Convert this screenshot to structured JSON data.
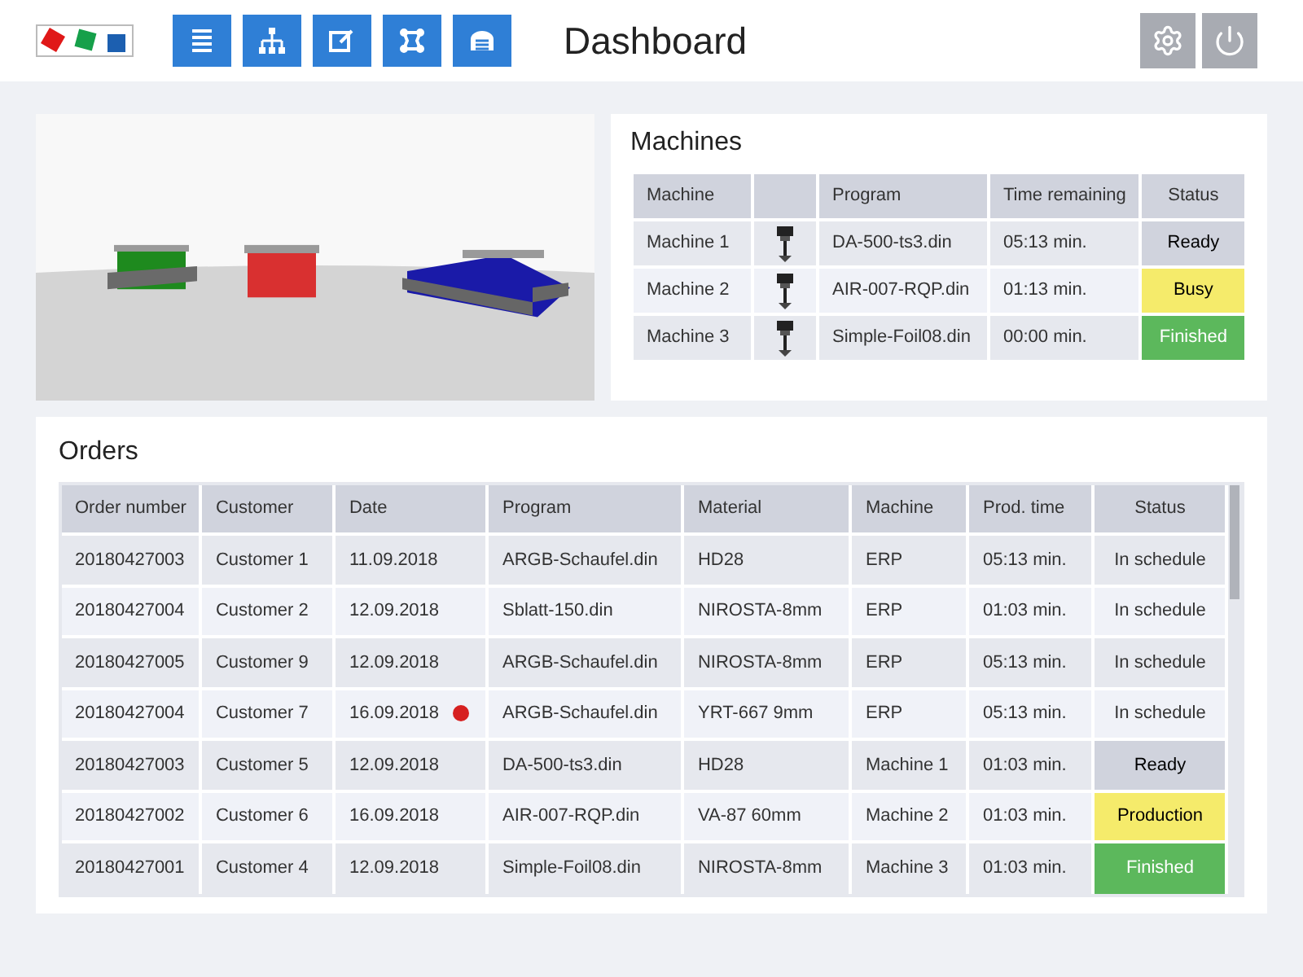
{
  "header": {
    "title": "Dashboard"
  },
  "machines": {
    "title": "Machines",
    "columns": [
      "Machine",
      "",
      "Program",
      "Time remaining",
      "Status"
    ],
    "rows": [
      {
        "machine": "Machine 1",
        "program": "DA-500-ts3.din",
        "time": "05:13 min.",
        "status": "Ready",
        "kind": "ready"
      },
      {
        "machine": "Machine 2",
        "program": "AIR-007-RQP.din",
        "time": "01:13 min.",
        "status": "Busy",
        "kind": "busy"
      },
      {
        "machine": "Machine 3",
        "program": "Simple-Foil08.din",
        "time": "00:00 min.",
        "status": "Finished",
        "kind": "finished"
      }
    ]
  },
  "orders": {
    "title": "Orders",
    "columns": [
      "Order number",
      "Customer",
      "Date",
      "Program",
      "Material",
      "Machine",
      "Prod. time",
      "Status"
    ],
    "rows": [
      {
        "cells": [
          "20180427003",
          "Customer 1",
          "11.09.2018",
          "ARGB-Schaufel.din",
          "HD28",
          "ERP",
          "05:13 min."
        ],
        "status": "In schedule",
        "kind": "plain",
        "alert": false
      },
      {
        "cells": [
          "20180427004",
          "Customer 2",
          "12.09.2018",
          "Sblatt-150.din",
          "NIROSTA-8mm",
          "ERP",
          "01:03 min."
        ],
        "status": "In schedule",
        "kind": "plain",
        "alert": false
      },
      {
        "cells": [
          "20180427005",
          "Customer 9",
          "12.09.2018",
          "ARGB-Schaufel.din",
          "NIROSTA-8mm",
          "ERP",
          "05:13 min."
        ],
        "status": "In schedule",
        "kind": "plain",
        "alert": false
      },
      {
        "cells": [
          "20180427004",
          "Customer 7",
          "16.09.2018",
          "ARGB-Schaufel.din",
          "YRT-667  9mm",
          "ERP",
          "05:13 min."
        ],
        "status": "In schedule",
        "kind": "plain",
        "alert": true
      },
      {
        "cells": [
          "20180427003",
          "Customer 5",
          "12.09.2018",
          "DA-500-ts3.din",
          "HD28",
          "Machine 1",
          "01:03 min."
        ],
        "status": "Ready",
        "kind": "ready",
        "alert": false
      },
      {
        "cells": [
          "20180427002",
          "Customer 6",
          "16.09.2018",
          "AIR-007-RQP.din",
          "VA-87 60mm",
          "Machine 2",
          "01:03 min."
        ],
        "status": "Production",
        "kind": "busy",
        "alert": false
      },
      {
        "cells": [
          "20180427001",
          "Customer 4",
          "12.09.2018",
          "Simple-Foil08.din",
          "NIROSTA-8mm",
          "Machine 3",
          "01:03 min."
        ],
        "status": "Finished",
        "kind": "finished",
        "alert": false
      }
    ]
  }
}
